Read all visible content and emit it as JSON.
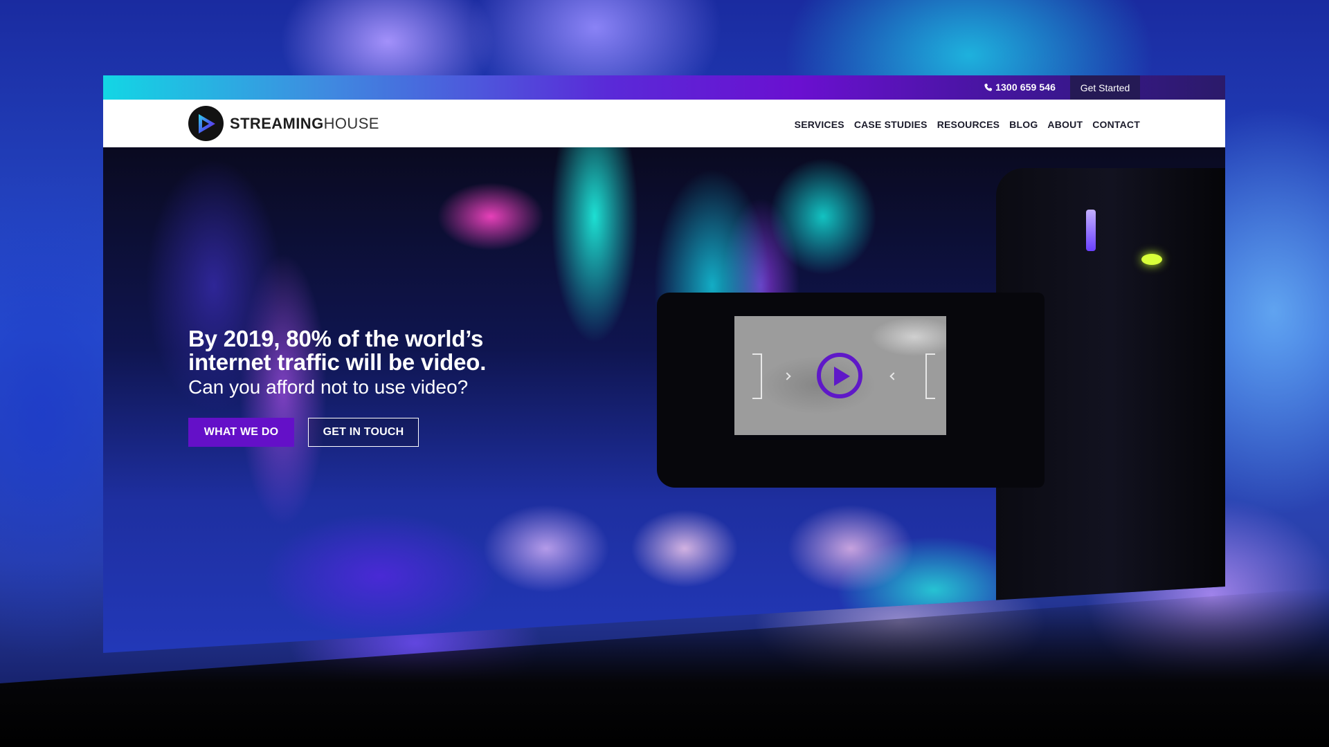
{
  "topbar": {
    "phone": "1300 659 546",
    "cta_label": "Get Started"
  },
  "brand": {
    "name_bold": "STREAMING",
    "name_light": "HOUSE"
  },
  "nav": {
    "items": [
      {
        "label": "SERVICES"
      },
      {
        "label": "CASE STUDIES"
      },
      {
        "label": "RESOURCES"
      },
      {
        "label": "BLOG"
      },
      {
        "label": "ABOUT"
      },
      {
        "label": "CONTACT"
      }
    ]
  },
  "hero": {
    "headline_line1": "By 2019, 80% of the world’s",
    "headline_line2": "internet traffic will be video.",
    "subhead": "Can you afford not to use video?",
    "primary_button": "WHAT WE DO",
    "secondary_button": "GET IN TOUCH"
  },
  "colors": {
    "accent_purple": "#6410c8",
    "topbar_cyan": "#13d6e4",
    "topbar_purple": "#6a10d0",
    "cta_bg": "#251a55"
  },
  "icons": {
    "phone": "phone-icon",
    "logo": "play-triangle-logo-icon",
    "video_play": "play-icon"
  }
}
